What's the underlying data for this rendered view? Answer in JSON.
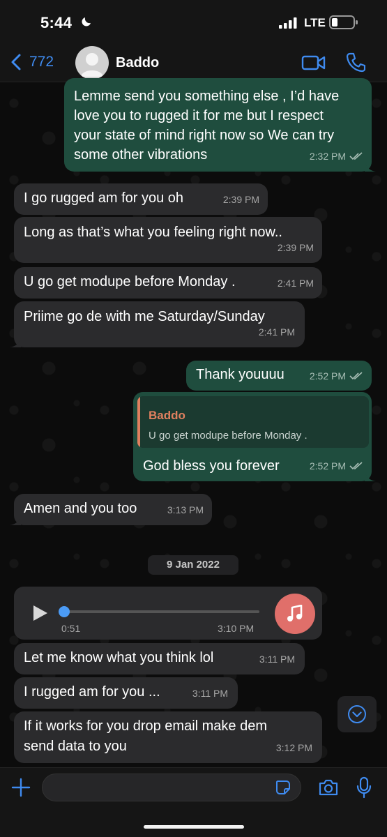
{
  "status_bar": {
    "time": "5:44",
    "network": "LTE",
    "moon_icon": "moon-icon",
    "signal_icon": "signal-bars-icon",
    "battery_icon": "battery-icon"
  },
  "header": {
    "back_count": "772",
    "contact_name": "Baddo",
    "back_icon": "chevron-left-icon",
    "video_icon": "video-camera-icon",
    "call_icon": "phone-icon"
  },
  "messages": [
    {
      "direction": "out",
      "lines": [
        "Lemme send you something else , I’d have",
        "love you to rugged it for me but I respect",
        "your state of mind right now so We can try",
        "some other vibrations"
      ],
      "time": "2:32 PM",
      "read": true
    },
    {
      "direction": "in",
      "lines": [
        "I go rugged am for you oh"
      ],
      "time": "2:39 PM"
    },
    {
      "direction": "in",
      "lines": [
        "Long as that’s what you feeling right now.."
      ],
      "time": "2:39 PM"
    },
    {
      "direction": "in",
      "lines": [
        "U go get modupe before Monday ."
      ],
      "time": "2:41 PM"
    },
    {
      "direction": "in",
      "lines": [
        "Priime go de with me Saturday/Sunday"
      ],
      "time": "2:41 PM"
    },
    {
      "direction": "out",
      "lines": [
        "Thank youuuu"
      ],
      "time": "2:52 PM",
      "read": true
    },
    {
      "direction": "out",
      "reply_to": {
        "author": "Baddo",
        "text": "U go get modupe before Monday ."
      },
      "lines": [
        "God bless you forever"
      ],
      "time": "2:52 PM",
      "read": true
    },
    {
      "direction": "in",
      "lines": [
        "Amen and you too"
      ],
      "time": "3:13 PM"
    }
  ],
  "date_divider": "9 Jan 2022",
  "voice_note": {
    "duration": "0:51",
    "time": "3:10 PM",
    "play_icon": "play-icon",
    "avatar_icon": "music-note-icon",
    "progress": 0
  },
  "later_messages": [
    {
      "direction": "in",
      "lines": [
        "Let me know what you think lol"
      ],
      "time": "3:11 PM"
    },
    {
      "direction": "in",
      "lines": [
        "I rugged am for you ..."
      ],
      "time": "3:11 PM"
    },
    {
      "direction": "in",
      "lines": [
        "If it works for you drop email make dem",
        "send data to you"
      ],
      "time": "3:12 PM"
    }
  ],
  "scroll_down_icon": "chevron-down-circle-icon",
  "input_bar": {
    "placeholder": "",
    "plus_icon": "plus-icon",
    "sticker_icon": "sticker-icon",
    "camera_icon": "camera-icon",
    "mic_icon": "microphone-icon"
  },
  "colors": {
    "accent": "#3f8bf0",
    "outgoing_bubble": "#1f4d3e",
    "incoming_bubble": "#2b2b2d",
    "reply_author": "#e0805f",
    "voice_avatar": "#e06f6a"
  }
}
